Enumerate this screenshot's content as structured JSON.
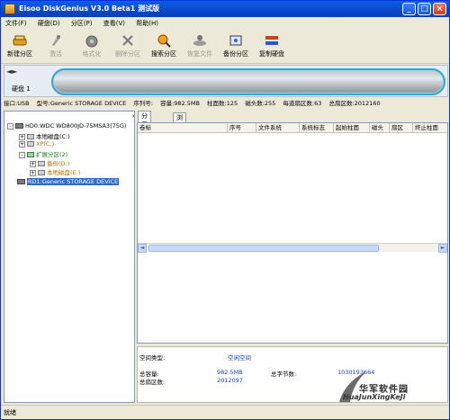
{
  "window": {
    "title": "Eisoo DiskGenius V3.0 Beta1 测试版"
  },
  "menu": [
    "文件(F)",
    "硬盘(D)",
    "分区(P)",
    "查看(V)",
    "帮助(H)"
  ],
  "toolbar": [
    {
      "label": "新建分区",
      "icon": "new-partition-icon",
      "enabled": true
    },
    {
      "label": "激活",
      "icon": "activate-icon",
      "enabled": false
    },
    {
      "label": "格式化",
      "icon": "format-icon",
      "enabled": false
    },
    {
      "label": "删除分区",
      "icon": "delete-partition-icon",
      "enabled": false
    },
    {
      "label": "搜索分区",
      "icon": "search-partition-icon",
      "enabled": true
    },
    {
      "label": "恢复文件",
      "icon": "recover-files-icon",
      "enabled": false
    },
    {
      "label": "备份分区",
      "icon": "backup-partition-icon",
      "enabled": true
    },
    {
      "label": "复制硬盘",
      "icon": "copy-disk-icon",
      "enabled": true
    }
  ],
  "diskmap": {
    "label": "硬盘 1",
    "nav_left": "◄",
    "nav_right": "►"
  },
  "diskinfo": {
    "interface": "接口:USB",
    "model": "型号:Generic STORAGE DEVICE",
    "serial": "序列号:",
    "capacity": "容量:982.5MB",
    "cylinders": "柱面数:125",
    "heads": "磁头数:255",
    "sectors": "每道扇区数:63",
    "total_sectors": "总扇区数:2012160"
  },
  "tree": {
    "hd0": "HD0:WDC WD800JD-75MSA3(75G)",
    "local_c": "本地磁盘(C:)",
    "xp_c": "XP(C:)",
    "extended": "扩展分区(2)",
    "backup_d": "备份(D:)",
    "local_e": "本地磁盘(E:)",
    "rd1": "RD1:Generic STORAGE DEVICE",
    "close_glyph": "×"
  },
  "tabs": [
    "分区参数",
    "浏览文件"
  ],
  "columns": [
    "卷标",
    "序号",
    "文件系统",
    "系统标志",
    "起始柱面",
    "磁头",
    "扇区",
    "终止柱面"
  ],
  "details": {
    "space_type_label": "空间类型:",
    "space_type_value": "空闲空间",
    "total_capacity_label": "总容量:",
    "total_capacity_value": "982.5MB",
    "total_bytes_label": "总字节数:",
    "total_bytes_value": "1030193664",
    "total_sectors_label": "总扇区数:",
    "total_sectors_value": "2012097"
  },
  "status": "就绪",
  "watermark": {
    "line1": "华军软件园",
    "line2": "HuaJunXingKeJi"
  }
}
